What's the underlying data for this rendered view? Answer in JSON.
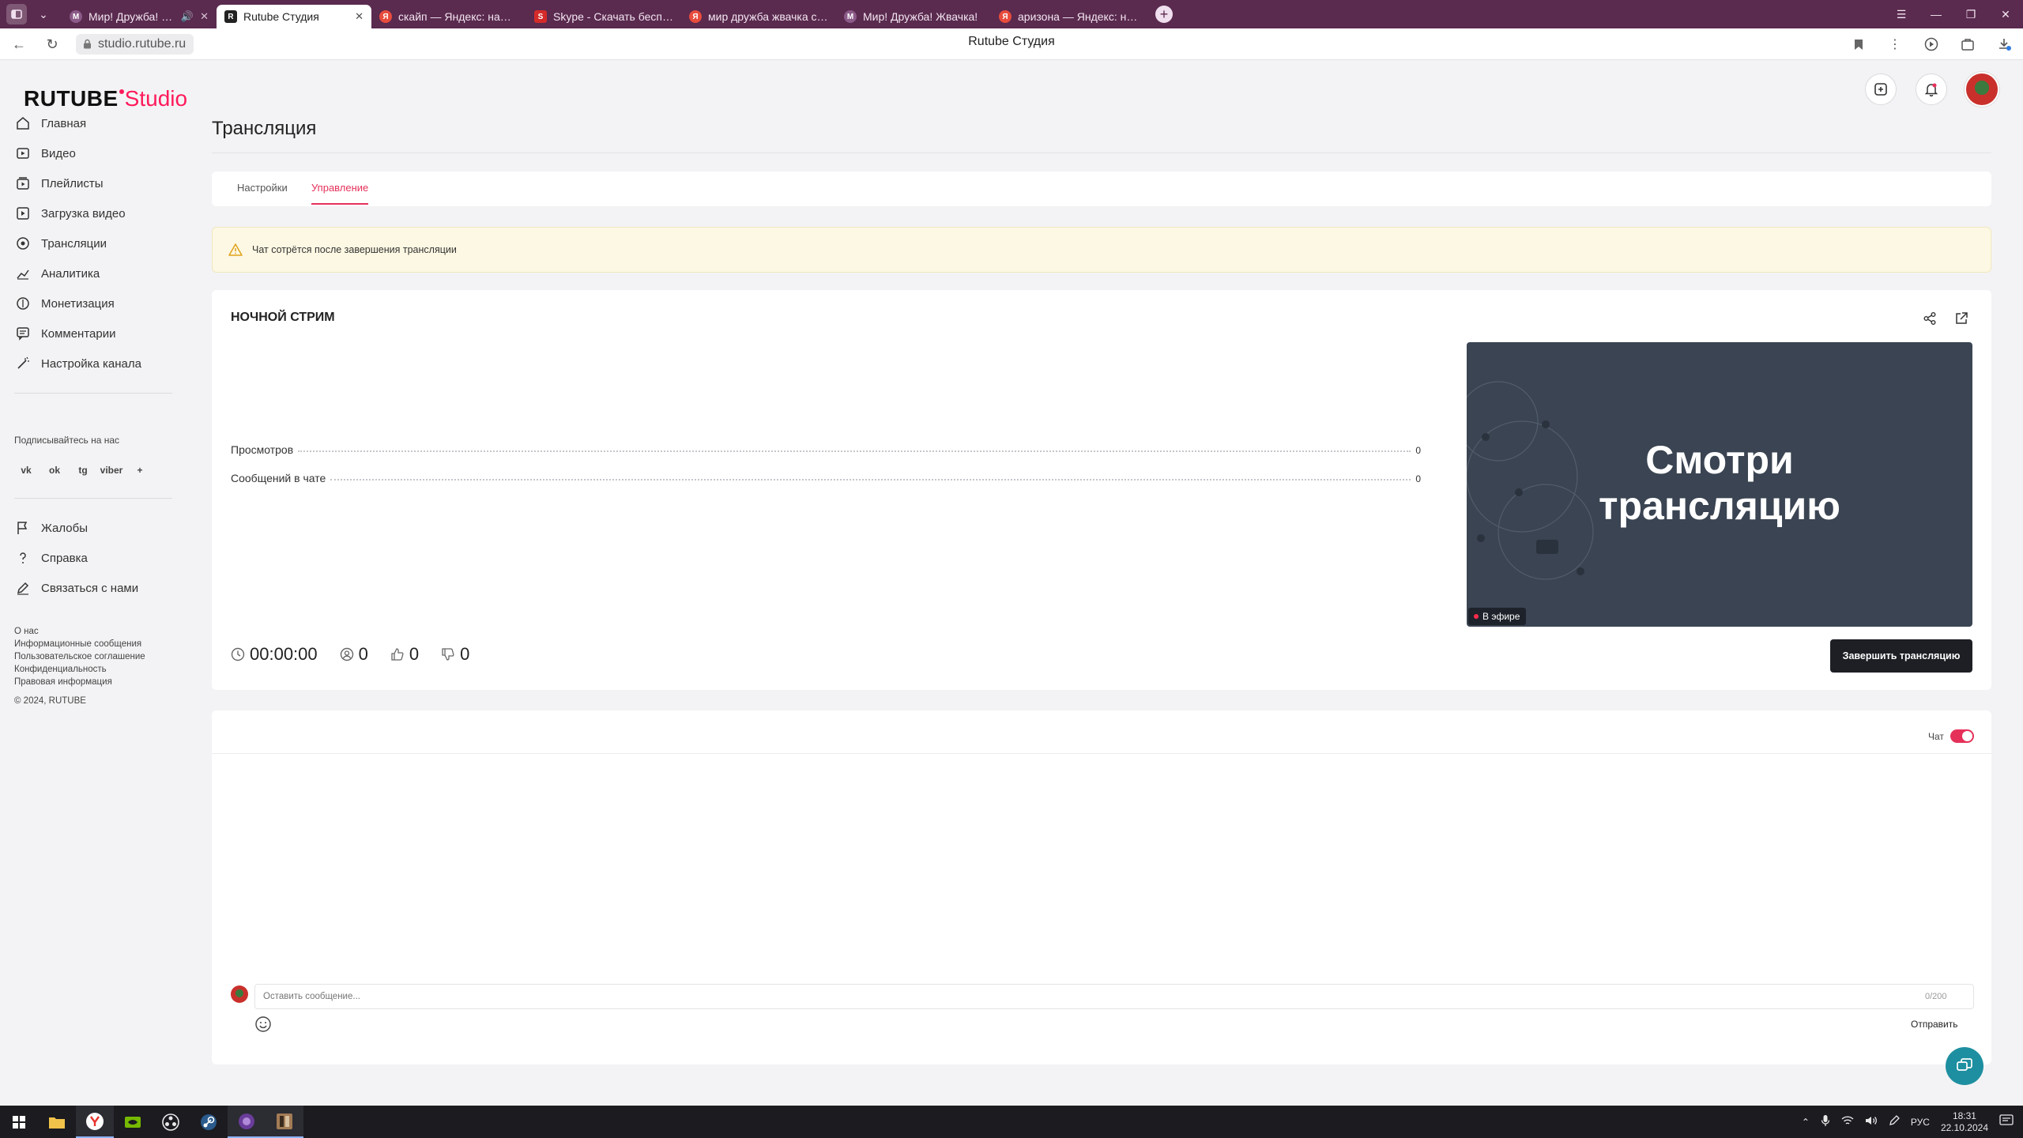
{
  "browser": {
    "tabs": [
      {
        "title": "Мир! Дружба! Жвач",
        "favicon": "w",
        "active": false
      },
      {
        "title": "Rutube Студия",
        "favicon": "rt",
        "active": true
      },
      {
        "title": "скайп — Яндекс: нашлось",
        "favicon": "ya",
        "active": false
      },
      {
        "title": "Skype - Скачать бесплатно",
        "favicon": "sk",
        "active": false
      },
      {
        "title": "мир дружба жвачка смотреть",
        "favicon": "ya",
        "active": false
      },
      {
        "title": "Мир! Дружба! Жвачка!",
        "favicon": "w",
        "active": false
      },
      {
        "title": "аризона — Яндекс: нашлось",
        "favicon": "ya",
        "active": false
      }
    ],
    "url": "studio.rutube.ru",
    "page_title": "Rutube Студия"
  },
  "logo": {
    "brand": "RUTUBE",
    "product": "Studio",
    "accent": "#ff1a5b"
  },
  "sidebar": {
    "items": [
      {
        "label": "Главная",
        "icon": "home-icon"
      },
      {
        "label": "Видео",
        "icon": "video-icon"
      },
      {
        "label": "Плейлисты",
        "icon": "playlist-icon"
      },
      {
        "label": "Загрузка видео",
        "icon": "upload-icon"
      },
      {
        "label": "Трансляции",
        "icon": "broadcast-icon"
      },
      {
        "label": "Аналитика",
        "icon": "analytics-icon"
      },
      {
        "label": "Монетизация",
        "icon": "coin-icon"
      },
      {
        "label": "Комментарии",
        "icon": "comments-icon"
      },
      {
        "label": "Настройка канала",
        "icon": "wand-icon"
      }
    ],
    "subscribe_label": "Подписывайтесь на нас",
    "social": [
      "vk",
      "ok",
      "tg",
      "viber",
      "+"
    ],
    "support_items": [
      {
        "label": "Жалобы",
        "icon": "flag-icon"
      },
      {
        "label": "Справка",
        "icon": "question-icon"
      },
      {
        "label": "Связаться с нами",
        "icon": "pencil-icon"
      }
    ],
    "footer_links": [
      "О нас",
      "Информационные сообщения",
      "Пользовательское соглашение",
      "Конфиденциальность",
      "Правовая информация"
    ],
    "copyright": "© 2024, RUTUBE"
  },
  "page": {
    "title": "Трансляция",
    "tabs": [
      {
        "label": "Настройки",
        "active": false
      },
      {
        "label": "Управление",
        "active": true
      }
    ],
    "warning": "Чат сотрётся после завершения трансляции"
  },
  "stream": {
    "name": "НОЧНОЙ СТРИМ",
    "stats": [
      {
        "label": "Просмотров",
        "value": "0"
      },
      {
        "label": "Сообщений в чате",
        "value": "0"
      }
    ],
    "preview_text_line1": "Смотри",
    "preview_text_line2": "трансляцию",
    "live_badge": "В эфире",
    "duration": "00:00:00",
    "viewers": "0",
    "likes": "0",
    "dislikes": "0",
    "end_button": "Завершить трансляцию"
  },
  "chat": {
    "toggle_label": "Чат",
    "toggle_on": true,
    "input_placeholder": "Оставить сообщение...",
    "counter": "0/200",
    "send_label": "Отправить"
  },
  "taskbar": {
    "lang": "РУС",
    "time": "18:31",
    "date": "22.10.2024"
  },
  "colors": {
    "accent": "#e5315a",
    "dark_button": "#1d1f24",
    "warning_bg": "#fdf8e3",
    "tab_strip": "#5a2a4f"
  }
}
